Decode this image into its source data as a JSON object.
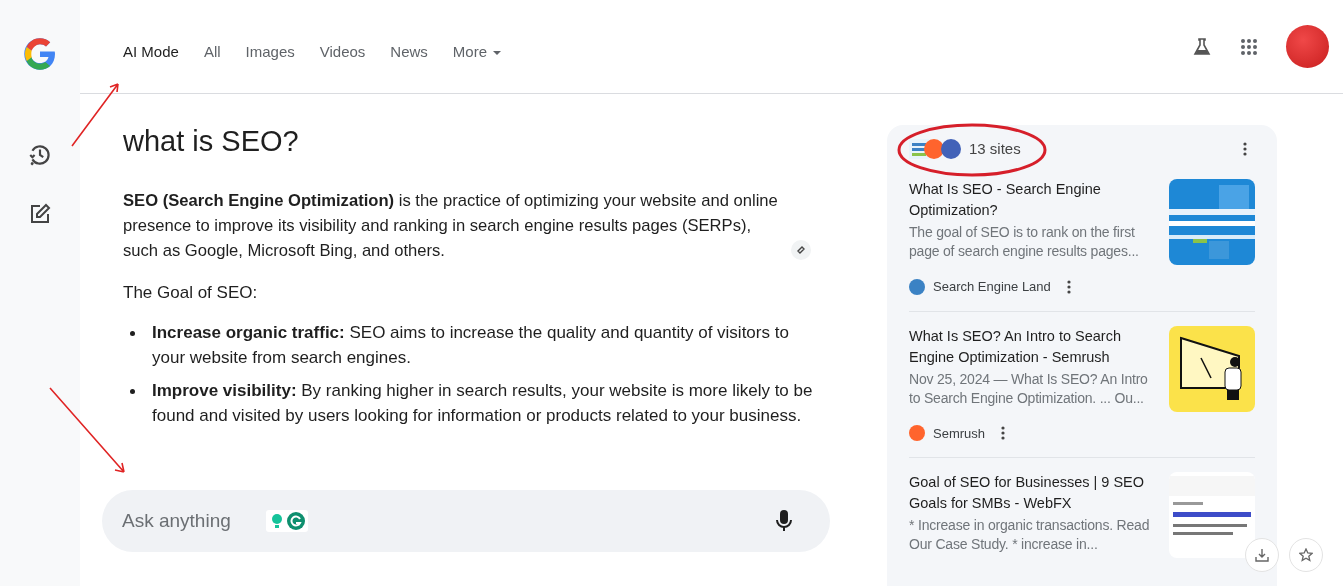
{
  "nav": {
    "tabs": [
      {
        "label": "AI Mode",
        "selected": true,
        "kind": "tab"
      },
      {
        "label": "All",
        "selected": false,
        "kind": "tab"
      },
      {
        "label": "Images",
        "selected": false,
        "kind": "tab"
      },
      {
        "label": "Videos",
        "selected": false,
        "kind": "tab"
      },
      {
        "label": "News",
        "selected": false,
        "kind": "tab"
      },
      {
        "label": "More",
        "selected": false,
        "kind": "dropdown"
      }
    ]
  },
  "query": "what is SEO?",
  "answer": {
    "intro": "**SEO (Search Engine Optimization)** is the practice of optimizing your website and online presence to improve its visibility and ranking in search engine results pages (SERPs), such as Google, Microsoft Bing, and others.",
    "heading": "The Goal of SEO:",
    "bullets": [
      {
        "term": "Increase organic traffic:",
        "text": "SEO aims to increase the quality and quantity of visitors to your website from search engines."
      },
      {
        "term": "Improve visibility:",
        "text": "By ranking higher in search results, your website is more likely to be found and visited by users looking for information or products related to your business."
      }
    ]
  },
  "input": {
    "placeholder": "Ask anything"
  },
  "sources": {
    "count": "13 sites",
    "items": [
      {
        "title": "What Is SEO - Search Engine Optimization?",
        "snippet": "The goal of SEO is to rank on the first page of search engine results pages...",
        "site": "Search Engine Land",
        "color": "#3b82c4"
      },
      {
        "title": "What Is SEO? An Intro to Search Engine Optimization - Semrush",
        "snippet": "Nov 25, 2024 — What Is SEO? An Intro to Search Engine Optimization. ... Ou...",
        "site": "Semrush",
        "color": "#ff642d"
      },
      {
        "title": "Goal of SEO for Businesses | 9 SEO Goals for SMBs - WebFX",
        "snippet": "* Increase in organic transactions. Read Our Case Study. * increase in..."
      }
    ]
  }
}
